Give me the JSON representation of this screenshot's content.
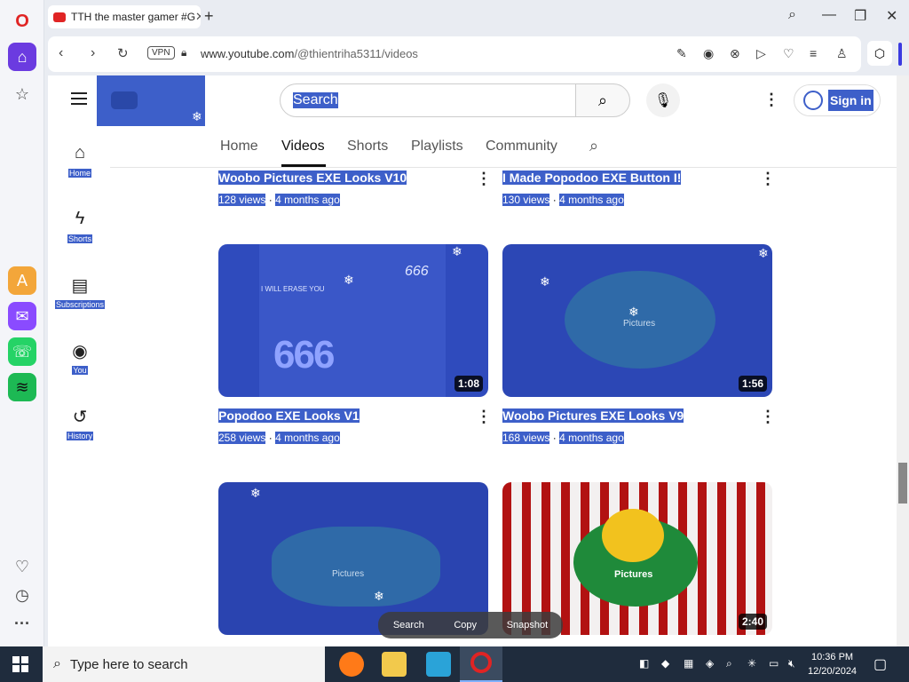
{
  "browser": {
    "tab_title": "TTH the master gamer #G",
    "url_domain": "www.youtube.com",
    "url_path": "/@thientriha5311/videos",
    "vpn_label": "VPN",
    "new_tab_glyph": "+",
    "tab_close_glyph": "✕"
  },
  "youtube": {
    "search_placeholder": "Search",
    "sign_in_label": "Sign in",
    "channel_tabs": [
      "Home",
      "Videos",
      "Shorts",
      "Playlists",
      "Community"
    ],
    "guide": [
      "Home",
      "Shorts",
      "Subscriptions",
      "You",
      "History"
    ],
    "videos": [
      {
        "title": "Woobo Pictures EXE Looks V10",
        "views": "128 views",
        "age": "4 months ago"
      },
      {
        "title": "I Made Popodoo EXE Button I!",
        "views": "130 views",
        "age": "4 months ago"
      },
      {
        "title": "Popodoo EXE Looks V1",
        "views": "258 views",
        "age": "4 months ago",
        "duration": "1:08"
      },
      {
        "title": "Woobo Pictures EXE Looks V9",
        "views": "168 views",
        "age": "4 months ago",
        "duration": "1:56"
      },
      {
        "duration": ""
      },
      {
        "duration": "2:40"
      }
    ],
    "meta_separator": "·"
  },
  "thumb_text": {
    "t1_line1": "I WILL ERASE YOU",
    "t1_line2": "666",
    "t1_big": "666",
    "t4_label": "Pictures"
  },
  "context_menu": [
    "Search",
    "Copy",
    "Snapshot"
  ],
  "taskbar": {
    "search_placeholder": "Type here to search",
    "time": "10:36 PM",
    "date": "12/20/2024"
  },
  "colors": {
    "selection": "#3d5fc9",
    "brand_red": "#e02424"
  }
}
